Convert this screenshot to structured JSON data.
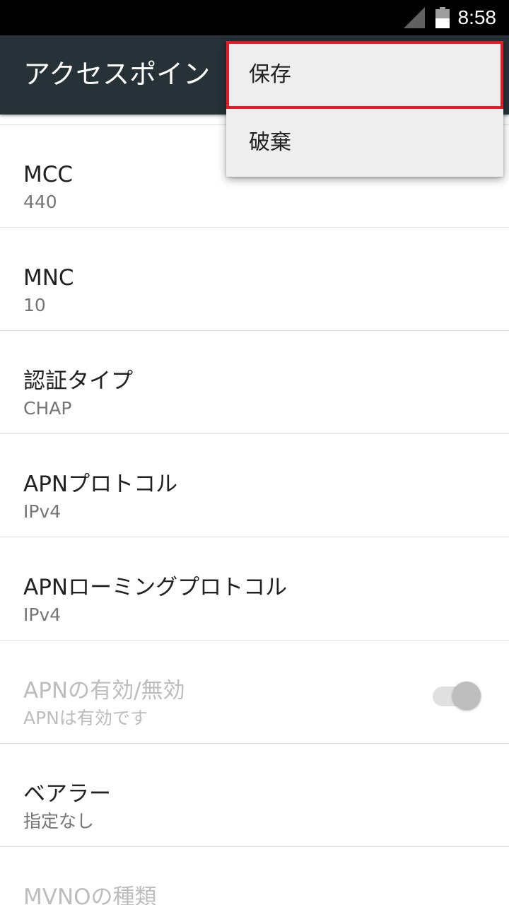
{
  "status_bar": {
    "time": "8:58",
    "signal_icon": "cellular-signal-icon",
    "battery_icon": "battery-icon"
  },
  "toolbar": {
    "title": "アクセスポイン"
  },
  "menu": {
    "items": [
      {
        "label": "保存",
        "highlighted": true
      },
      {
        "label": "破棄"
      }
    ],
    "highlight_color": "#e11c26"
  },
  "prefs": [
    {
      "title": "MCC",
      "summary": "440"
    },
    {
      "title": "MNC",
      "summary": "10"
    },
    {
      "title": "認証タイプ",
      "summary": "CHAP"
    },
    {
      "title": "APNプロトコル",
      "summary": "IPv4"
    },
    {
      "title": "APNローミングプロトコル",
      "summary": "IPv4"
    },
    {
      "title": "APNの有効/無効",
      "summary": "APNは有効です",
      "disabled": true,
      "toggle": true
    },
    {
      "title": "ベアラー",
      "summary": "指定なし"
    },
    {
      "title": "MVNOの種類",
      "disabled": true
    }
  ],
  "colors": {
    "toolbar": "#263238",
    "status_bar": "#000000",
    "menu_background": "#eeeeee"
  }
}
